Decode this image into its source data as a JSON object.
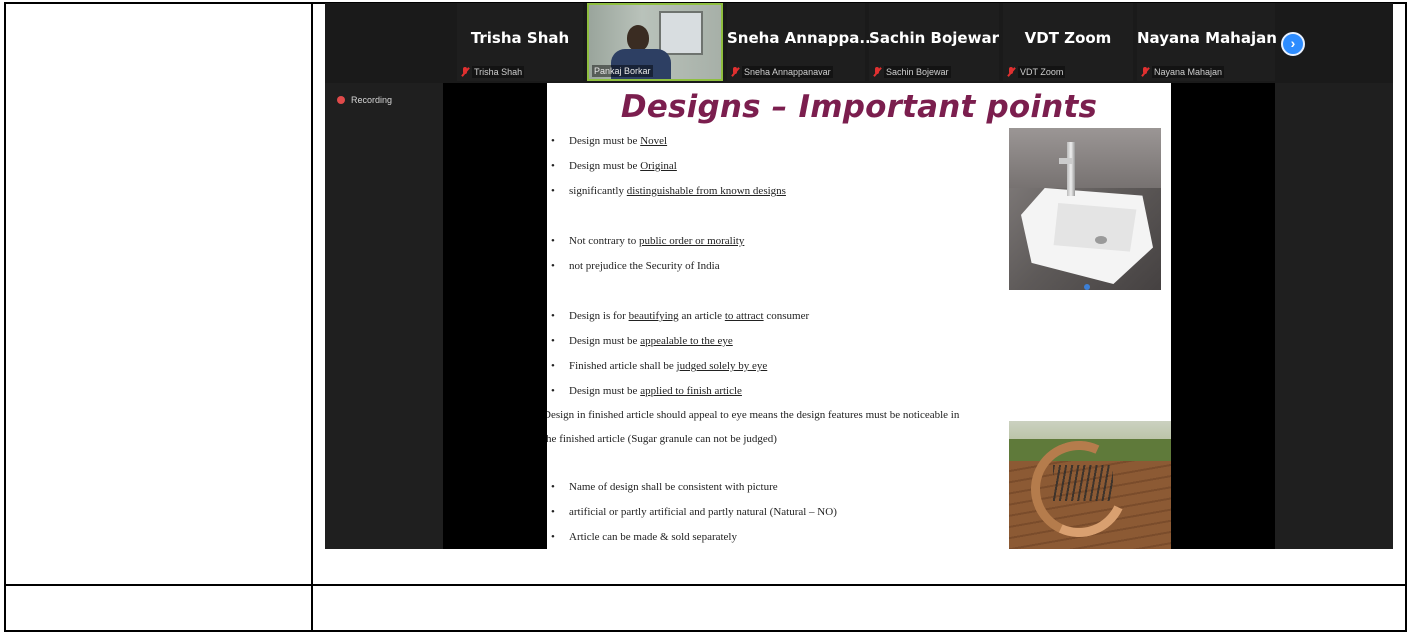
{
  "meeting": {
    "participants": [
      {
        "name": "Trisha Shah",
        "label": "Trisha Shah",
        "muted": true
      },
      {
        "name": "",
        "label": "Pankaj Borkar",
        "video": true
      },
      {
        "name": "Sneha  Annappa...",
        "label": "Sneha Annappanavar",
        "muted": true
      },
      {
        "name": "Sachin Bojewar",
        "label": "Sachin Bojewar",
        "muted": true
      },
      {
        "name": "VDT Zoom",
        "label": "VDT Zoom",
        "muted": true
      },
      {
        "name": "Nayana Mahajan",
        "label": "Nayana Mahajan",
        "muted": true
      }
    ],
    "next_icon": "chevron-right-icon",
    "recording_label": "Recording",
    "colors": {
      "accent": "#2d8cff",
      "mute": "#e03030",
      "title": "#7b1e4e"
    }
  },
  "slide": {
    "title": "Designs – Important points",
    "bullets": [
      {
        "pre": "Design must be ",
        "u": "Novel",
        "post": ""
      },
      {
        "pre": "Design must be ",
        "u": "Original",
        "post": ""
      },
      {
        "pre": "significantly ",
        "u": "distinguishable from known designs",
        "post": ""
      },
      {
        "pre": "Not contrary to ",
        "u": "public order or morality",
        "post": ""
      },
      {
        "pre": "not prejudice the Security of India",
        "u": "",
        "post": ""
      },
      {
        "pre": "Design is for ",
        "u": "beautifying",
        "mid": " an article ",
        "u2": "to attract",
        "post": " consumer"
      },
      {
        "pre": "Design must be ",
        "u": "appealable to the eye",
        "post": ""
      },
      {
        "pre": "Finished article shall be ",
        "u": "judged solely by eye",
        "post": ""
      },
      {
        "pre": "Design must be ",
        "u": "applied to finish article",
        "post": ""
      },
      {
        "pre": "Name of design shall be consistent with picture",
        "u": "",
        "post": ""
      },
      {
        "pre": "artificial or  partly artificial and partly natural  (Natural – NO)",
        "u": "",
        "post": ""
      },
      {
        "pre": "Article can be made & sold separately",
        "u": "",
        "post": ""
      }
    ],
    "paragraph_1": "Design in finished article should appeal to eye means the design features must be noticeable in",
    "paragraph_2": "the finished article (Sugar granule can not be judged)"
  }
}
